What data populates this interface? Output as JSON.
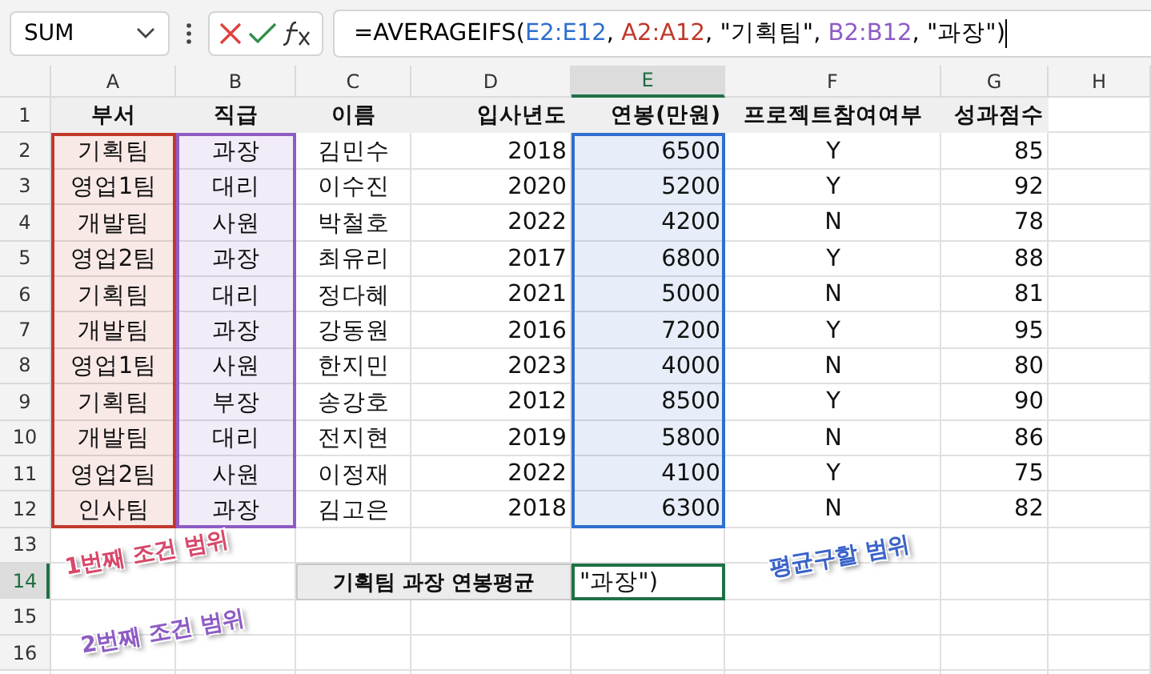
{
  "name_box": "SUM",
  "formula_parts": [
    {
      "text": "=AVERAGEIFS(",
      "ref": "E2:E12",
      "color": "#2f6fce"
    },
    {
      "text": ", ",
      "ref": "A2:A12",
      "color": "#c0392b"
    },
    {
      "text": ", \"기획팀\", ",
      "ref": "B2:B12",
      "color": "#8e5cc4"
    },
    {
      "text": ", \"과장\")"
    }
  ],
  "columns": [
    {
      "letter": "A",
      "selected": false,
      "kind": "text",
      "color": "#c0392b"
    },
    {
      "letter": "B",
      "selected": false,
      "kind": "text",
      "color": "#8e5cc4"
    },
    {
      "letter": "C",
      "selected": false,
      "kind": "text"
    },
    {
      "letter": "D",
      "selected": false,
      "kind": "number"
    },
    {
      "letter": "E",
      "selected": true,
      "kind": "number",
      "color": "#2f6fce"
    },
    {
      "letter": "F",
      "selected": false,
      "kind": "text"
    },
    {
      "letter": "G",
      "selected": false,
      "kind": "number"
    },
    {
      "letter": "H",
      "selected": false
    }
  ],
  "header_row": [
    "부서",
    "직급",
    "이름",
    "입사년도",
    "연봉(만원)",
    "프로젝트참여여부",
    "성과점수"
  ],
  "rows": [
    [
      "기획팀",
      "과장",
      "김민수",
      "2018",
      "6500",
      "Y",
      "85"
    ],
    [
      "영업1팀",
      "대리",
      "이수진",
      "2020",
      "5200",
      "Y",
      "92"
    ],
    [
      "개발팀",
      "사원",
      "박철호",
      "2022",
      "4200",
      "N",
      "78"
    ],
    [
      "영업2팀",
      "과장",
      "최유리",
      "2017",
      "6800",
      "Y",
      "88"
    ],
    [
      "기획팀",
      "대리",
      "정다혜",
      "2021",
      "5000",
      "N",
      "81"
    ],
    [
      "개발팀",
      "과장",
      "강동원",
      "2016",
      "7200",
      "Y",
      "95"
    ],
    [
      "영업1팀",
      "사원",
      "한지민",
      "2023",
      "4000",
      "N",
      "80"
    ],
    [
      "기획팀",
      "부장",
      "송강호",
      "2012",
      "8500",
      "Y",
      "90"
    ],
    [
      "개발팀",
      "대리",
      "전지현",
      "2019",
      "5800",
      "N",
      "86"
    ],
    [
      "영업2팀",
      "사원",
      "이정재",
      "2022",
      "4100",
      "Y",
      "75"
    ],
    [
      "인사팀",
      "과장",
      "김고은",
      "2018",
      "6300",
      "N",
      "82"
    ]
  ],
  "row_numbers": [
    {
      "label": "1",
      "selected": false
    },
    {
      "label": "2",
      "selected": false
    },
    {
      "label": "3",
      "selected": false
    },
    {
      "label": "4",
      "selected": false
    },
    {
      "label": "5",
      "selected": false
    },
    {
      "label": "6",
      "selected": false
    },
    {
      "label": "7",
      "selected": false
    },
    {
      "label": "8",
      "selected": false
    },
    {
      "label": "9",
      "selected": false
    },
    {
      "label": "10",
      "selected": false
    },
    {
      "label": "11",
      "selected": false
    },
    {
      "label": "12",
      "selected": false
    },
    {
      "label": "13",
      "selected": false
    },
    {
      "label": "14",
      "selected": true
    },
    {
      "label": "15",
      "selected": false
    },
    {
      "label": "16",
      "selected": false
    }
  ],
  "summary": {
    "label": "기획팀 과장 연봉평균",
    "value": "\"과장\")"
  },
  "annotations": [
    {
      "text": "1번째 조건 범위",
      "color": "#d8486a"
    },
    {
      "text": "2번째 조건 범위",
      "color": "#8e5cc4"
    },
    {
      "text": "평균구할 범위",
      "color": "#3b63c9"
    }
  ]
}
